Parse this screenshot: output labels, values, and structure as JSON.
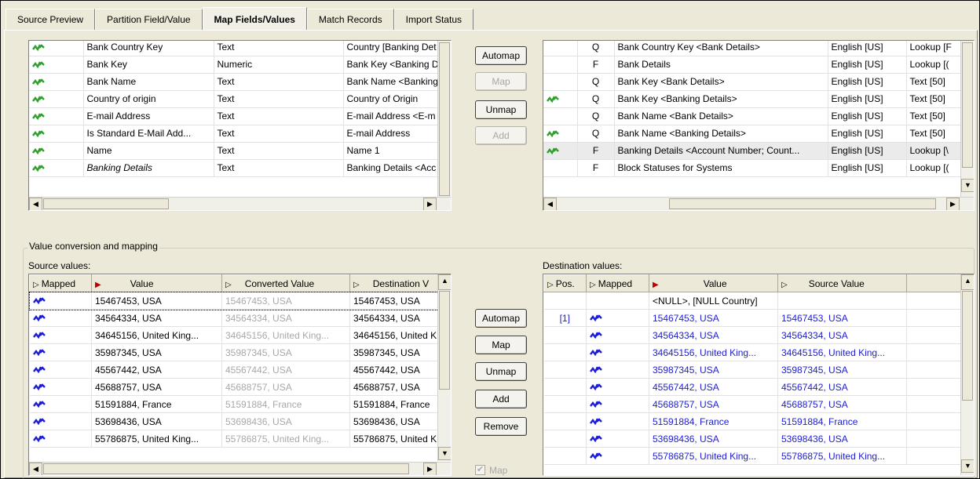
{
  "tabs": [
    {
      "label": "Source Preview",
      "active": false
    },
    {
      "label": "Partition Field/Value",
      "active": false
    },
    {
      "label": "Map Fields/Values",
      "active": true
    },
    {
      "label": "Match Records",
      "active": false
    },
    {
      "label": "Import Status",
      "active": false
    }
  ],
  "source_fields": [
    {
      "name": "Bank Country Key",
      "type": "Text",
      "dest": "Country [Banking Det",
      "mapped": true
    },
    {
      "name": "Bank Key",
      "type": "Numeric",
      "dest": "Bank Key <Banking D",
      "mapped": true
    },
    {
      "name": "Bank Name",
      "type": "Text",
      "dest": "Bank Name <Banking",
      "mapped": true
    },
    {
      "name": "Country of origin",
      "type": "Text",
      "dest": "Country of Origin",
      "mapped": true
    },
    {
      "name": "E-mail Address",
      "type": "Text",
      "dest": "E-mail Address <E-m",
      "mapped": true
    },
    {
      "name": "Is Standard E-Mail Add...",
      "type": "Text",
      "dest": "E-mail Address",
      "mapped": true
    },
    {
      "name": "Name",
      "type": "Text",
      "dest": "Name 1",
      "mapped": true
    },
    {
      "name": "Banking Details",
      "type": "Text",
      "dest": "Banking Details <Acc",
      "mapped": true,
      "selected": true
    }
  ],
  "field_buttons": {
    "automap": "Automap",
    "map": "Map",
    "unmap": "Unmap",
    "add": "Add"
  },
  "dest_fields": [
    {
      "code": "Q",
      "name": "Bank Country Key <Bank Details>",
      "lang": "English [US]",
      "type": "Lookup [F",
      "mapped": false
    },
    {
      "code": "F",
      "name": "Bank Details",
      "lang": "English [US]",
      "type": "Lookup [(",
      "mapped": false
    },
    {
      "code": "Q",
      "name": "Bank Key <Bank Details>",
      "lang": "English [US]",
      "type": "Text [50]",
      "mapped": false
    },
    {
      "code": "Q",
      "name": "Bank Key <Banking Details>",
      "lang": "English [US]",
      "type": "Text [50]",
      "mapped": true
    },
    {
      "code": "Q",
      "name": "Bank Name <Bank Details>",
      "lang": "English [US]",
      "type": "Text [50]",
      "mapped": false
    },
    {
      "code": "Q",
      "name": "Bank Name <Banking Details>",
      "lang": "English [US]",
      "type": "Text [50]",
      "mapped": true
    },
    {
      "code": "F",
      "name": "Banking Details <Account Number; Count...",
      "lang": "English [US]",
      "type": "Lookup [\\",
      "mapped": true,
      "selected": true
    },
    {
      "code": "F",
      "name": "Block Statuses for Systems",
      "lang": "English [US]",
      "type": "Lookup [(",
      "mapped": false
    }
  ],
  "value_section": {
    "title": "Value conversion and mapping",
    "source_label": "Source values:",
    "dest_label": "Destination values:",
    "source_headers": {
      "mapped": "Mapped",
      "value": "Value",
      "converted": "Converted Value",
      "destination": "Destination V"
    },
    "dest_headers": {
      "pos": "Pos.",
      "mapped": "Mapped",
      "value": "Value",
      "source_value": "Source Value"
    },
    "source_values": [
      {
        "value": "15467453, USA",
        "converted": "15467453, USA",
        "destination": "15467453, USA"
      },
      {
        "value": "34564334, USA",
        "converted": "34564334, USA",
        "destination": "34564334, USA"
      },
      {
        "value": "34645156, United King...",
        "converted": "34645156, United King...",
        "destination": "34645156, United K"
      },
      {
        "value": "35987345, USA",
        "converted": "35987345, USA",
        "destination": "35987345, USA"
      },
      {
        "value": "45567442, USA",
        "converted": "45567442, USA",
        "destination": "45567442, USA"
      },
      {
        "value": "45688757, USA",
        "converted": "45688757, USA",
        "destination": "45688757, USA"
      },
      {
        "value": "51591884, France",
        "converted": "51591884, France",
        "destination": "51591884, France"
      },
      {
        "value": "53698436, USA",
        "converted": "53698436, USA",
        "destination": "53698436, USA"
      },
      {
        "value": "55786875, United King...",
        "converted": "55786875, United King...",
        "destination": "55786875, United K"
      }
    ],
    "value_buttons": {
      "automap": "Automap",
      "map": "Map",
      "unmap": "Unmap",
      "add": "Add",
      "remove": "Remove"
    },
    "map_checkbox_label": "Map",
    "dest_values": [
      {
        "pos": "",
        "mapped": false,
        "value": "<NULL>, [NULL Country]",
        "source_value": ""
      },
      {
        "pos": "[1]",
        "mapped": true,
        "value": "15467453, USA",
        "source_value": "15467453, USA"
      },
      {
        "pos": "",
        "mapped": true,
        "value": "34564334, USA",
        "source_value": "34564334, USA"
      },
      {
        "pos": "",
        "mapped": true,
        "value": "34645156, United King...",
        "source_value": "34645156, United King..."
      },
      {
        "pos": "",
        "mapped": true,
        "value": "35987345, USA",
        "source_value": "35987345, USA"
      },
      {
        "pos": "",
        "mapped": true,
        "value": "45567442, USA",
        "source_value": "45567442, USA"
      },
      {
        "pos": "",
        "mapped": true,
        "value": "45688757, USA",
        "source_value": "45688757, USA"
      },
      {
        "pos": "",
        "mapped": true,
        "value": "51591884, France",
        "source_value": "51591884, France"
      },
      {
        "pos": "",
        "mapped": true,
        "value": "53698436, USA",
        "source_value": "53698436, USA"
      },
      {
        "pos": "",
        "mapped": true,
        "value": "55786875, United King...",
        "source_value": "55786875, United King..."
      }
    ]
  },
  "colors": {
    "mapped_icon": "#2ea02e",
    "dest_value_text": "#1c1cd8",
    "window_bg": "#ece9d8"
  }
}
